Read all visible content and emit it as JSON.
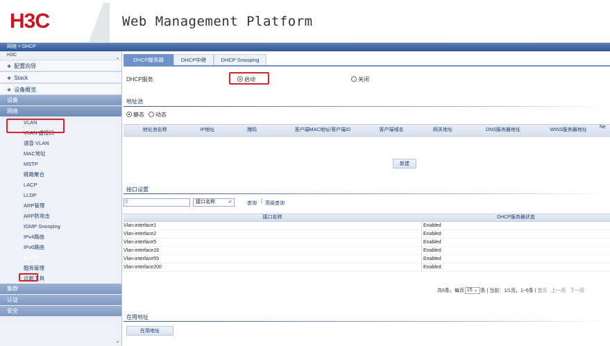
{
  "header": {
    "logo": "H3C",
    "title": "Web Management Platform"
  },
  "breadcrumb": "网络 > DHCP",
  "sidebar": {
    "root_label": "H3C",
    "wizard": "配置向导",
    "stack": "Stack",
    "overview": "设备概览",
    "cat_device": "设备",
    "cat_network": "网络",
    "network_items": [
      "VLAN",
      "VLAN 虚接口",
      "语音 VLAN",
      "MAC地址",
      "MSTP",
      "链路聚合",
      "LACP",
      "LLDP",
      "ARP管理",
      "ARP防攻击",
      "IGMP Snooping",
      "IPv4路由",
      "IPv6路由",
      "DHCP",
      "服务管理",
      "诊断工具"
    ],
    "cat_cluster": "集群",
    "cat_auth": "认证",
    "cat_security": "安全"
  },
  "tabs": [
    "DHCP服务器",
    "DHCP中继",
    "DHCP Snooping"
  ],
  "dhcp_service": {
    "label": "DHCP服务",
    "enable": "启动",
    "disable": "关闭",
    "selected": "enable"
  },
  "pool": {
    "section_title": "地址池",
    "static": "静态",
    "dynamic": "动态",
    "columns": [
      "地址池名称",
      "IP地址",
      "掩码",
      "客户端MAC地址/客户端ID",
      "客户端域名",
      "网关地址",
      "DNS服务器地址",
      "WINS服务器地址",
      "Ne"
    ],
    "new_button": "新建"
  },
  "interface": {
    "section_title": "接口设置",
    "search_placeholder": "",
    "search_field": "接口名称",
    "query": "查询",
    "advanced_query": "高级查询",
    "columns": [
      "接口名称",
      "DHCP服务器状态"
    ],
    "rows": [
      {
        "name": "Vlan-interface1",
        "status": "Enabled"
      },
      {
        "name": "Vlan-interface2",
        "status": "Enabled"
      },
      {
        "name": "Vlan-interface5",
        "status": "Enabled"
      },
      {
        "name": "Vlan-interface16",
        "status": "Enabled"
      },
      {
        "name": "Vlan-interface55",
        "status": "Enabled"
      },
      {
        "name": "Vlan-interface200",
        "status": "Enabled"
      }
    ],
    "pager": {
      "total": "共6条，每页",
      "page_size": "15",
      "per_page_suffix": "条 | 当前：1/1页，1~6条 |",
      "first": "首页",
      "prev": "上一页",
      "next": "下一页"
    }
  },
  "in_use": {
    "section_title": "在用地址",
    "button": "在用地址"
  },
  "colors": {
    "brand_red": "#d0121b",
    "accent_blue": "#2f5896",
    "highlight_red": "#e02020"
  }
}
